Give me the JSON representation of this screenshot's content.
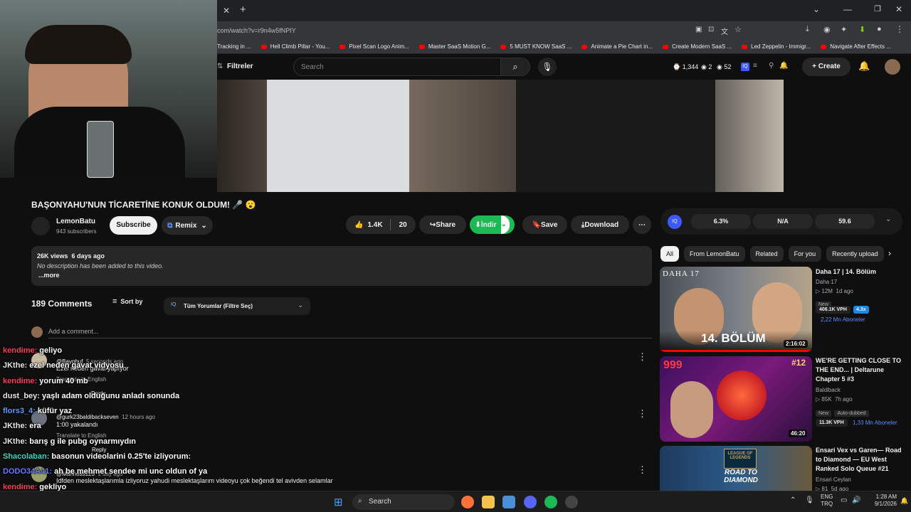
{
  "browser": {
    "url": "com/watch?v=r9n4w5fNPIY",
    "bookmarks": [
      "Tracking in ...",
      "Hell Climb Pillar - You...",
      "Pixel Scan Logo Anim...",
      "Master SaaS Motion G...",
      "5 MUST KNOW SaaS ...",
      "Animate a Pie Chart in...",
      "Create Modern SaaS ...",
      "Led Zeppelin - Immigr...",
      "Navigate After Effects ..."
    ]
  },
  "ytheader": {
    "filter_label": "Filtreler",
    "search_placeholder": "Search",
    "stats": {
      "views": "1,344",
      "two": "2",
      "fiftytwo": "52"
    },
    "create_label": "Create"
  },
  "video": {
    "title": "BAŞONYAHU'NUN TİCARETİNE KONUK OLDUM! 🎤 😮",
    "channel": "LemonBatu",
    "subscribers": "943 subscribers",
    "subscribe_label": "Subscribe",
    "remix_label": "Remix",
    "likes": "1.4K",
    "dislikes": "20",
    "share_label": "Share",
    "indir_label": "İndir",
    "save_label": "Save",
    "download_label": "Download",
    "metrics": [
      "6.3%",
      "N/A",
      "59.6"
    ],
    "desc_views": "26K views  6 days ago",
    "desc_text": "No description has been added to this video.",
    "desc_more": "...more"
  },
  "comments": {
    "count": "189 Comments",
    "sort_label": "Sort by",
    "filter_label": "Tüm Yorumlar (Filtre Seç)",
    "add_placeholder": "Add a comment...",
    "items": [
      {
        "name": "@Bayghuf",
        "time": "5 seconds ago",
        "text": "Ezel neden gavat yapıyor",
        "translate": "Translate to English",
        "reply": "Reply"
      },
      {
        "name": "@gurk23baldibackseven",
        "time": "12 hours ago",
        "text": "1:00 yakalandı",
        "translate": "Translate to English",
        "reply": "Reply"
      },
      {
        "name": "@Mannoss123",
        "time": "1 day ago",
        "text": "Idfden meslektaşlarımla izliyoruz yahudi meslektaşlarım videoyu çok beğendi tel avivden selamlar"
      }
    ]
  },
  "chat": [
    {
      "user": "kendime:",
      "color": "#ff3b5c",
      "msg": "geliyo"
    },
    {
      "user": "JKthe:",
      "color": "#e5e5e5",
      "msg": "ezel neden gavat vidyosu"
    },
    {
      "user": "kendime:",
      "color": "#ff3b5c",
      "msg": "yorum 40 mb"
    },
    {
      "user": "dust_bey:",
      "color": "#e5e5e5",
      "msg": "yaşlı adam olduğunu anladı sonunda"
    },
    {
      "user": "flors3_4:",
      "color": "#5b9bff",
      "msg": "küfür yaz"
    },
    {
      "user": "JKthe:",
      "color": "#e5e5e5",
      "msg": "era"
    },
    {
      "user": "JKthe:",
      "color": "#e5e5e5",
      "msg": "barış g ile pubg oynarmıydın"
    },
    {
      "user": "Shacolaban:",
      "color": "#36d6c3",
      "msg": "basonun videolarini 0.25'te izliyorum:"
    },
    {
      "user": "DODO34A41:",
      "color": "#6a7bff",
      "msg": "ah be mehmet sendee mi unc oldun of ya"
    },
    {
      "user": "kendime:",
      "color": "#ff3b5c",
      "msg": "gekliyo"
    }
  ],
  "sidebar": {
    "chips": [
      "All",
      "From LemonBatu",
      "Related",
      "For you",
      "Recently upload"
    ],
    "videos": [
      {
        "title": "Daha 17 | 14. Bölüm",
        "channel": "Daha 17",
        "meta": "▷ 12M  1d ago",
        "badge": "New",
        "vph": "406.1K VPH",
        "mult": "4.3x",
        "subs": "2,22 Mn Aboneler",
        "duration": "2:16:02",
        "thumb_text": "14. BÖLÜM",
        "thumb_logo": "DAHA 17"
      },
      {
        "title": "WE'RE GETTING CLOSE TO THE END... | Deltarune Chapter 5 #3",
        "channel": "Baldiback",
        "meta": "▷ 85K  7h ago",
        "badge": "New",
        "badge2": "Auto-dubbed",
        "vph": "11.3K VPH",
        "subs": "1,33 Mn Aboneler",
        "duration": "46:20",
        "thumb_text": "#12"
      },
      {
        "title": "Ensari Vex vs Garen— Road to Diamond — EU West Ranked Solo Queue #21",
        "channel": "Ensari Ceylan",
        "meta": "▷ 81  5d ago",
        "thumb_text": "ROAD TO DIAMOND"
      }
    ]
  },
  "taskbar": {
    "search": "Search",
    "lang1": "ENG",
    "lang2": "TRQ",
    "time": "1:28 AM",
    "date": "9/1/2026"
  }
}
